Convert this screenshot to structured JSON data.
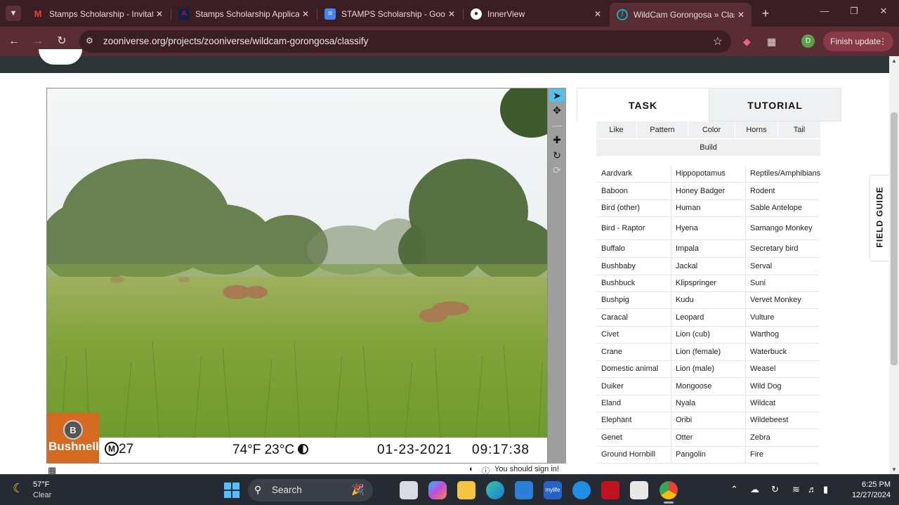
{
  "browser": {
    "tabs": [
      {
        "title": "Stamps Scholarship - Invitati",
        "icon": "gmail-icon",
        "color": "#ea4335"
      },
      {
        "title": "Stamps Scholarship Applicat",
        "icon": "university-icon",
        "color": "#cc0033"
      },
      {
        "title": "STAMPS Scholarship - Goog",
        "icon": "google-docs-icon",
        "color": "#4285f4"
      },
      {
        "title": "InnerView",
        "icon": "innerview-icon",
        "color": "#ffffff"
      },
      {
        "title": "WildCam Gorongosa » Class",
        "icon": "zooniverse-icon",
        "color": "#00979d"
      }
    ],
    "url": "zooniverse.org/projects/zooniverse/wildcam-gorongosa/classify",
    "avatar_letter": "D",
    "finish_update": "Finish update"
  },
  "camera": {
    "brand": "Bushnell",
    "moon": "M",
    "moon_num": "27",
    "temperature": "74°F 23°C",
    "date": "01-23-2021",
    "time": "09:17:38"
  },
  "signin": "You should sign in!",
  "task": {
    "tabs": {
      "task": "TASK",
      "tutorial": "TUTORIAL"
    },
    "filters": [
      "Like",
      "Pattern",
      "Color",
      "Horns",
      "Tail",
      "Build"
    ],
    "species": [
      [
        "Aardvark",
        "Hippopotamus",
        "Reptiles/Amphibians"
      ],
      [
        "Baboon",
        "Honey Badger",
        "Rodent"
      ],
      [
        "Bird (other)",
        "Human",
        "Sable Antelope"
      ],
      [
        "Bird - Raptor",
        "Hyena",
        "Samango Monkey"
      ],
      [
        "Buffalo",
        "Impala",
        "Secretary bird"
      ],
      [
        "Bushbaby",
        "Jackal",
        "Serval"
      ],
      [
        "Bushbuck",
        "Klipspringer",
        "Suni"
      ],
      [
        "Bushpig",
        "Kudu",
        "Vervet Monkey"
      ],
      [
        "Caracal",
        "Leopard",
        "Vulture"
      ],
      [
        "Civet",
        "Lion (cub)",
        "Warthog"
      ],
      [
        "Crane",
        "Lion (female)",
        "Waterbuck"
      ],
      [
        "Domestic animal",
        "Lion (male)",
        "Weasel"
      ],
      [
        "Duiker",
        "Mongoose",
        "Wild Dog"
      ],
      [
        "Eland",
        "Nyala",
        "Wildcat"
      ],
      [
        "Elephant",
        "Oribi",
        "Wildebeest"
      ],
      [
        "Genet",
        "Otter",
        "Zebra"
      ],
      [
        "Ground Hornbill",
        "Pangolin",
        "Fire"
      ]
    ]
  },
  "field_guide": "FIELD GUIDE",
  "taskbar": {
    "temp": "57°F",
    "condition": "Clear",
    "search": "Search",
    "time": "6:25 PM",
    "date": "12/27/2024"
  }
}
